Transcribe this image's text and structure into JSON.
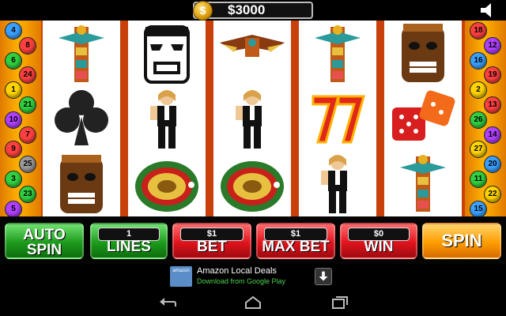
{
  "header": {
    "balance": "$3000",
    "coin_symbol": "$",
    "sound_icon": "speaker-icon"
  },
  "paylines_left": [
    {
      "n": "4",
      "color": "#3aa0ff"
    },
    {
      "n": "8",
      "color": "#ff4040"
    },
    {
      "n": "6",
      "color": "#30d040"
    },
    {
      "n": "24",
      "color": "#ff4040"
    },
    {
      "n": "1",
      "color": "#ffd400"
    },
    {
      "n": "21",
      "color": "#30d040"
    },
    {
      "n": "10",
      "color": "#b040ff"
    },
    {
      "n": "7",
      "color": "#ff4040"
    },
    {
      "n": "9",
      "color": "#ff4040"
    },
    {
      "n": "25",
      "color": "#9a9a9a"
    },
    {
      "n": "3",
      "color": "#30d040"
    },
    {
      "n": "23",
      "color": "#30d040"
    },
    {
      "n": "5",
      "color": "#b040ff"
    }
  ],
  "paylines_right": [
    {
      "n": "18",
      "color": "#ff4040"
    },
    {
      "n": "12",
      "color": "#b040ff"
    },
    {
      "n": "16",
      "color": "#3aa0ff"
    },
    {
      "n": "19",
      "color": "#ff4040"
    },
    {
      "n": "2",
      "color": "#ffd400"
    },
    {
      "n": "13",
      "color": "#ff4040"
    },
    {
      "n": "26",
      "color": "#30d040"
    },
    {
      "n": "14",
      "color": "#b040ff"
    },
    {
      "n": "27",
      "color": "#ffd400"
    },
    {
      "n": "20",
      "color": "#3aa0ff"
    },
    {
      "n": "11",
      "color": "#30d040"
    },
    {
      "n": "22",
      "color": "#ffd400"
    },
    {
      "n": "15",
      "color": "#3aa0ff"
    }
  ],
  "reels": [
    [
      "totem-icon",
      "club-icon",
      "tiki-mask-icon"
    ],
    [
      "tiki-mask-bw-icon",
      "dealer-icon",
      "roulette-icon"
    ],
    [
      "eagle-totem-icon",
      "dealer-icon",
      "roulette-icon"
    ],
    [
      "totem-icon",
      "lucky-seven-icon",
      "dealer-icon"
    ],
    [
      "tiki-mask-icon",
      "dice-icon",
      "totem-icon"
    ]
  ],
  "controls": {
    "auto_spin": "AUTO SPIN",
    "lines_value": "1",
    "lines_label": "LINES",
    "bet_value": "$1",
    "bet_label": "BET",
    "maxbet_value": "$1",
    "maxbet_label": "MAX BET",
    "win_value": "$0",
    "win_label": "WIN",
    "spin": "SPIN"
  },
  "ad": {
    "logo": "amazon",
    "title": "Amazon Local Deals",
    "subtitle": "Download from Google Play",
    "download_icon": "download-arrow-icon"
  },
  "nav": {
    "back_icon": "back-icon",
    "home_icon": "home-icon",
    "recents_icon": "recents-icon"
  },
  "colors": {
    "sidebar": "#ffb200",
    "reel_border": "#c9410a",
    "green": "#1d9b1d",
    "red": "#e0141d",
    "orange": "#ff9d00"
  }
}
